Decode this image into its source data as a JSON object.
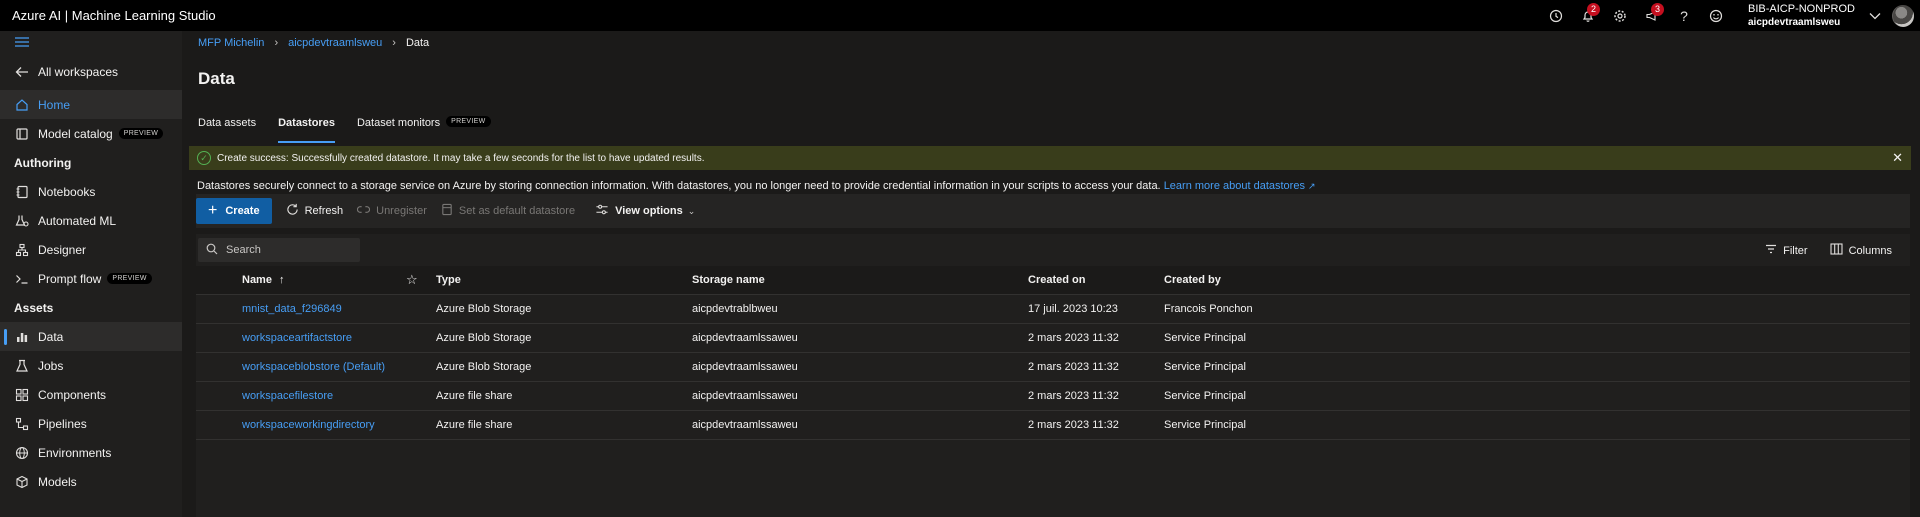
{
  "app": {
    "title": "Azure AI | Machine Learning Studio"
  },
  "topbar": {
    "notifications_count": "2",
    "announcements_count": "3",
    "org": "BIB-AICP-NONPROD",
    "workspace": "aicpdevtraamlsweu"
  },
  "sidebar": {
    "all_workspaces": "All workspaces",
    "home": "Home",
    "model_catalog": "Model catalog",
    "preview": "PREVIEW",
    "authoring_header": "Authoring",
    "notebooks": "Notebooks",
    "automated_ml": "Automated ML",
    "designer": "Designer",
    "prompt_flow": "Prompt flow",
    "assets_header": "Assets",
    "data": "Data",
    "jobs": "Jobs",
    "components": "Components",
    "pipelines": "Pipelines",
    "environments": "Environments",
    "models": "Models"
  },
  "breadcrumb": {
    "root": "MFP Michelin",
    "workspace": "aicpdevtraamlsweu",
    "current": "Data"
  },
  "page": {
    "title": "Data"
  },
  "tabs": {
    "data_assets": "Data assets",
    "datastores": "Datastores",
    "dataset_monitors": "Dataset monitors",
    "preview": "PREVIEW"
  },
  "message": {
    "bold": "Create success:",
    "text": " Successfully created datastore. It may take a few seconds for the list to have updated results."
  },
  "description": {
    "text": "Datastores securely connect to a storage service on Azure by storing connection information. With datastores, you no longer need to provide credential information in your scripts to access your data.",
    "link": "Learn more about datastores"
  },
  "commands": {
    "create": "Create",
    "refresh": "Refresh",
    "unregister": "Unregister",
    "set_default": "Set as default datastore",
    "view_options": "View options"
  },
  "table": {
    "search_placeholder": "Search",
    "filter": "Filter",
    "columns_btn": "Columns",
    "headers": {
      "name": "Name",
      "type": "Type",
      "storage": "Storage name",
      "created_on": "Created on",
      "created_by": "Created by"
    },
    "rows": [
      {
        "name": "mnist_data_f296849",
        "type": "Azure Blob Storage",
        "storage": "aicpdevtrablbweu",
        "created_on": "17 juil. 2023 10:23",
        "created_by": "Francois Ponchon"
      },
      {
        "name": "workspaceartifactstore",
        "type": "Azure Blob Storage",
        "storage": "aicpdevtraamlssaweu",
        "created_on": "2 mars 2023 11:32",
        "created_by": "Service Principal"
      },
      {
        "name": "workspaceblobstore (Default)",
        "type": "Azure Blob Storage",
        "storage": "aicpdevtraamlssaweu",
        "created_on": "2 mars 2023 11:32",
        "created_by": "Service Principal"
      },
      {
        "name": "workspacefilestore",
        "type": "Azure file share",
        "storage": "aicpdevtraamlssaweu",
        "created_on": "2 mars 2023 11:32",
        "created_by": "Service Principal"
      },
      {
        "name": "workspaceworkingdirectory",
        "type": "Azure file share",
        "storage": "aicpdevtraamlssaweu",
        "created_on": "2 mars 2023 11:32",
        "created_by": "Service Principal"
      }
    ]
  }
}
